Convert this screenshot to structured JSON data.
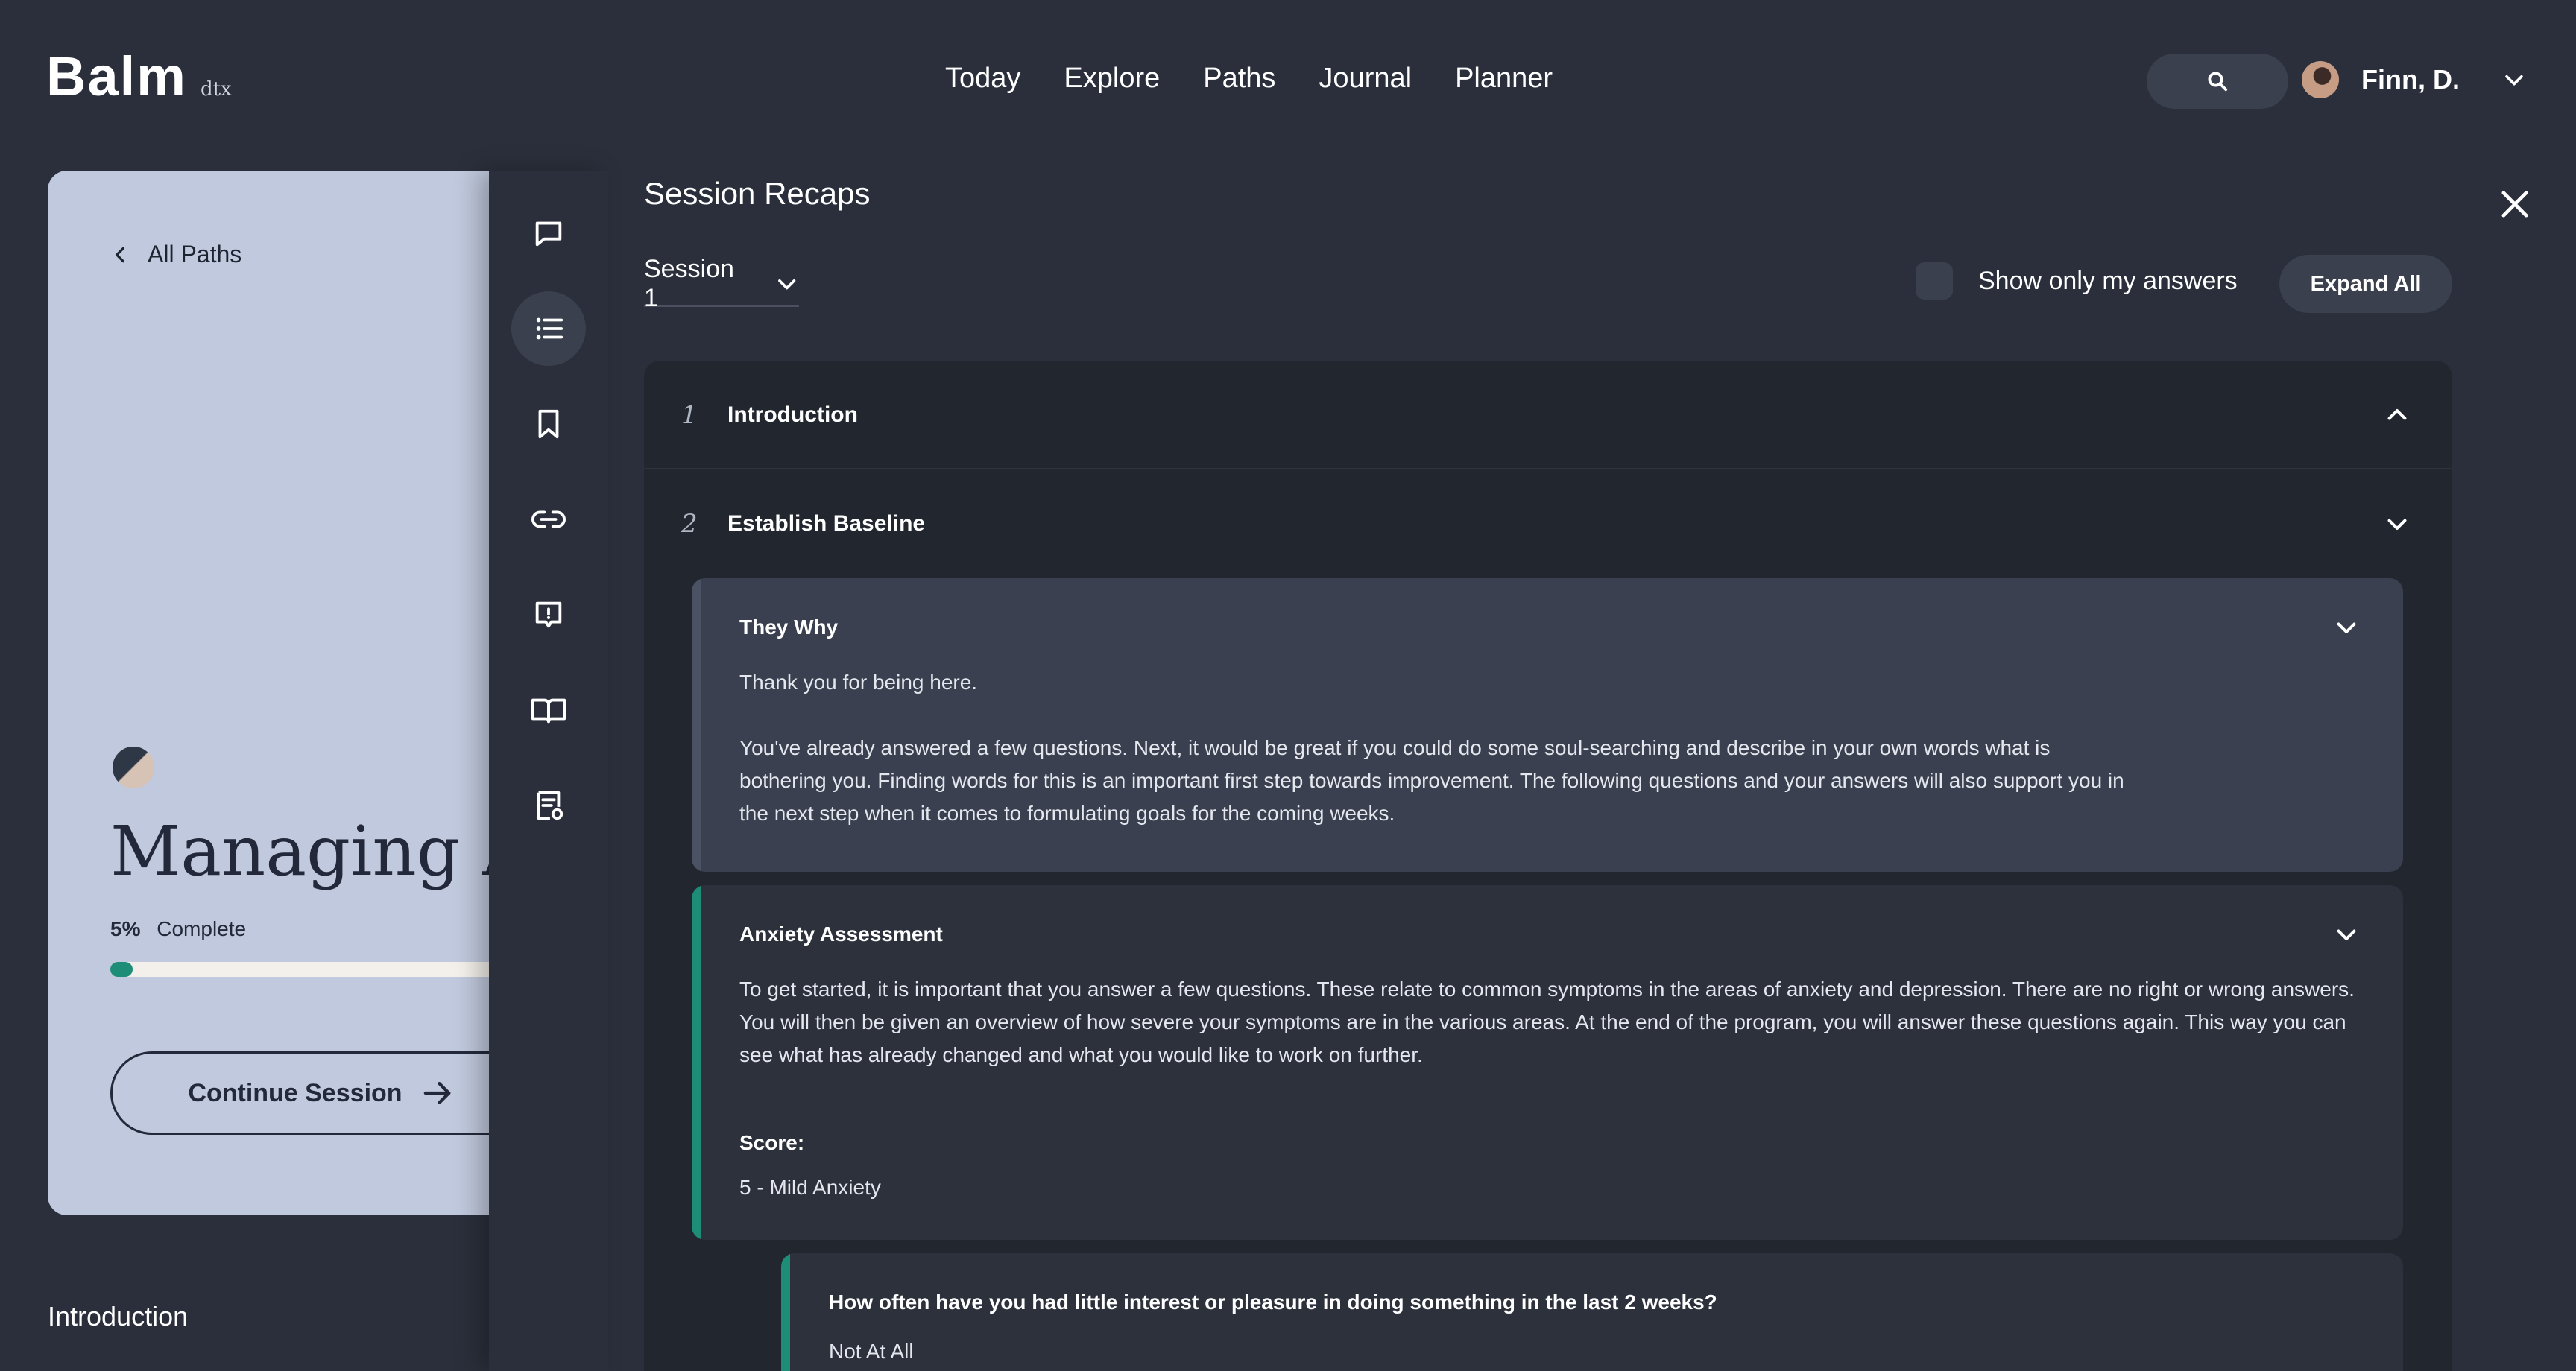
{
  "app": {
    "logo": "Balm",
    "logo_suffix": "dtx"
  },
  "nav": {
    "items": [
      "Today",
      "Explore",
      "Paths",
      "Journal",
      "Planner"
    ]
  },
  "user": {
    "name": "Finn, D."
  },
  "path_card": {
    "back_label": "All Paths",
    "title": "Managing Anxiety",
    "progress_value": "5%",
    "progress_label": "Complete",
    "progress_fraction": 0.05,
    "continue_label": "Continue Session"
  },
  "page_section": {
    "heading": "Introduction"
  },
  "tools": [
    "chat-icon",
    "list-icon",
    "bookmark-icon",
    "link-icon",
    "info-message-icon",
    "book-icon",
    "report-icon"
  ],
  "recaps": {
    "title": "Session Recaps",
    "session_selected": "Session 1",
    "toggle_label": "Show only my answers",
    "expand_label": "Expand All",
    "steps": [
      {
        "number": "1",
        "title": "Introduction"
      },
      {
        "number": "2",
        "title": "Establish Baseline"
      }
    ],
    "blocks": [
      {
        "title": "They Why",
        "paragraphs": [
          "Thank you for being here.",
          "You've already answered a few questions. Next, it would be great if you could do some soul-searching and describe in your own words what is bothering you. Finding words for this is an important first step towards improvement. The following questions and your answers will also support you in the next step when it comes to formulating goals for the coming weeks."
        ]
      },
      {
        "title": "Anxiety Assessment",
        "text": "To get started, it is important that you answer a few questions. These relate to common symptoms in the areas of anxiety and depression. There are no right or wrong answers. You will then be given an overview of how severe your symptoms are in the various areas. At the end of the program, you will answer these questions again. This way you can see what has already changed and what you would like to work on further.",
        "score_label": "Score:",
        "score_value": "5 - Mild Anxiety"
      },
      {
        "question": "How often have you had little interest or pleasure in doing something in the last 2 weeks?",
        "answer": "Not At All"
      }
    ]
  },
  "colors": {
    "background": "#2a2f3b",
    "card": "#c0c9dd",
    "accent": "#1e8d78",
    "accent_muted": "#4b5263"
  }
}
